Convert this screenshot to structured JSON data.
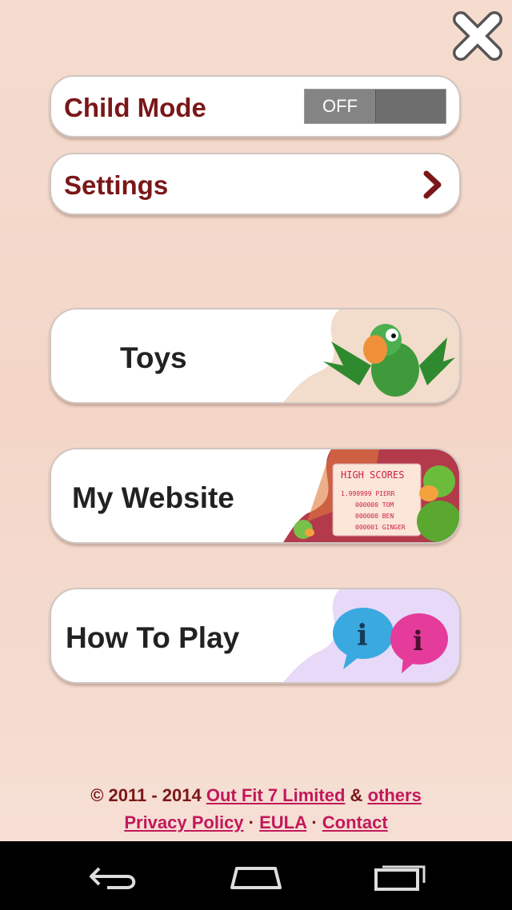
{
  "menu": {
    "child_mode_label": "Child Mode",
    "child_mode_state": "OFF",
    "settings_label": "Settings",
    "toys_label": "Toys",
    "website_label": "My Website",
    "howto_label": "How To Play"
  },
  "highscores": {
    "title": "HIGH SCORES",
    "rows": [
      "1.999999 PIERR",
      "000000 TOM",
      "000000 BEN",
      "000001 GINGER"
    ]
  },
  "footer": {
    "copyright": "© 2011 - 2014",
    "company_link": "Out Fit 7 Limited",
    "amp": "&",
    "others_link": "others",
    "privacy_link": "Privacy Policy",
    "sep": "·",
    "eula_link": "EULA",
    "contact_link": "Contact"
  },
  "icons": {
    "close": "close-icon",
    "chevron": "chevron-right-icon",
    "back": "back-icon",
    "home": "home-icon",
    "recents": "recents-icon"
  },
  "colors": {
    "label_red": "#7a1718",
    "link_pink": "#c2185b",
    "background": "#f5dccf"
  }
}
